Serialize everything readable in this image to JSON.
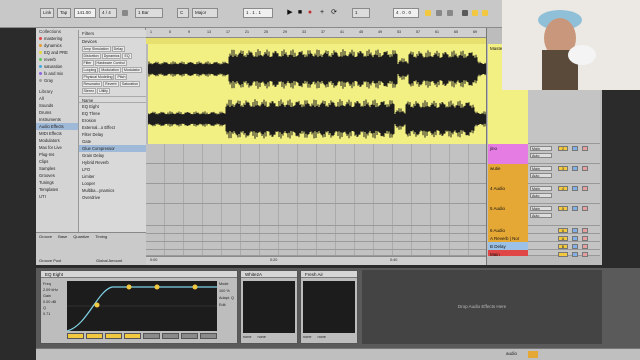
{
  "transport": {
    "link": "Link",
    "tap": "Tap",
    "tempo": "141.00",
    "signature": "4 / 4",
    "quantize": "1 Bar",
    "key": "C",
    "scale": "Major",
    "position": "1 . 1 . 1",
    "time_right": "4 . 0 . 0",
    "loop_len": "1"
  },
  "browser": {
    "collections_label": "Collections",
    "collections": [
      {
        "label": "mastering",
        "color": "#e14646"
      },
      {
        "label": "dynamics",
        "color": "#e69a32"
      },
      {
        "label": "EQ and PRE",
        "color": "#e6d632"
      },
      {
        "label": "reverb",
        "color": "#5cc85c"
      },
      {
        "label": "saturation",
        "color": "#3fa9e0"
      },
      {
        "label": "fx and mix",
        "color": "#8e67e0"
      },
      {
        "label": "Gray",
        "color": "#9a9a9a"
      }
    ],
    "library_label": "Library",
    "library": [
      "All",
      "Sounds",
      "Drums",
      "Instruments",
      "Audio Effects",
      "MIDI Effects",
      "Modulators",
      "Max for Live",
      "Plug-Ins",
      "Clips",
      "Samples",
      "Grooves",
      "Tunings",
      "Templates",
      "UTI"
    ],
    "library_selected": "Audio Effects",
    "filters_label": "Filters",
    "devices_label": "Devices",
    "filter_tags": [
      "Amp Simulation",
      "Delay",
      "Distortion",
      "Dynamics",
      "EQ",
      "Filter",
      "Hardware Control",
      "Looping",
      "Modulation",
      "Modulator",
      "Physical Modeling",
      "Pitch",
      "Resonator",
      "Reverb",
      "Saturation",
      "Stereo",
      "Utility"
    ],
    "name_header": "Name",
    "items": [
      "EQ Eight",
      "EQ Three",
      "Erosion",
      "External...o Effect",
      "Filter Delay",
      "Gate",
      "Glue Compressor",
      "Grain Delay",
      "Hybrid Reverb",
      "LFO",
      "Limiter",
      "Looper",
      "Multiba...ynamics",
      "Overdrive"
    ],
    "items_selected": "Glue Compressor",
    "groove_pool": {
      "label": "Groove Pool",
      "cols": [
        "Groove",
        "Base",
        "Quantize",
        "Timing"
      ]
    },
    "global_amount": "Global Amount"
  },
  "arrangement": {
    "ruler_marks": [
      "1",
      "5",
      "9",
      "13",
      "17",
      "21",
      "25",
      "29",
      "33",
      "37",
      "41",
      "45",
      "49",
      "53",
      "57",
      "61",
      "65",
      "69"
    ],
    "time_marks": [
      "0:00",
      "0:20",
      "0:40",
      "1:00"
    ],
    "clip_color": "#f2ef83"
  },
  "tracks": [
    {
      "name": "Master",
      "num": "1",
      "color": "#f2ef83"
    },
    {
      "name": "jino",
      "num": "2",
      "color": "#e47ce4"
    },
    {
      "name": "wutie",
      "num": "3",
      "color": "#e6a834"
    },
    {
      "name": "4 Audio",
      "num": "4",
      "color": "#e6a834"
    },
    {
      "name": "5 Audio",
      "num": "5",
      "color": "#e6a834"
    },
    {
      "name": "6 Audio",
      "num": "6",
      "color": "#e6a834"
    },
    {
      "name": "A Reverb | Nor",
      "num": "A",
      "color": "#e6a834"
    },
    {
      "name": "B Delay",
      "num": "B",
      "color": "#9bc2e6"
    },
    {
      "name": "Main",
      "num": "",
      "color": "#e14646"
    }
  ],
  "mixer_labels": {
    "audio_from": "Ext. In",
    "monitor": "Auto",
    "io": "Main",
    "sends": "1/2"
  },
  "devices": {
    "eq": {
      "title": "EQ Eight",
      "freq": "2.09 kHz",
      "gain": "0.00 dB",
      "q": "0.71",
      "scale": "100 %",
      "mode": "Mode",
      "adapt_q": "Adapt. Q",
      "edit": "Edit",
      "knob_freq": "Freq",
      "knob_gain": "Gain",
      "knob_q": "Q"
    },
    "white2a": {
      "title": "White2A",
      "footer_a": "none",
      "footer_b": "none"
    },
    "fresh_air": {
      "title": "Fresh Air",
      "footer_a": "none",
      "footer_b": "none"
    },
    "drop_hint": "Drop Audio Effects Here"
  },
  "status": {
    "track": "audio"
  }
}
